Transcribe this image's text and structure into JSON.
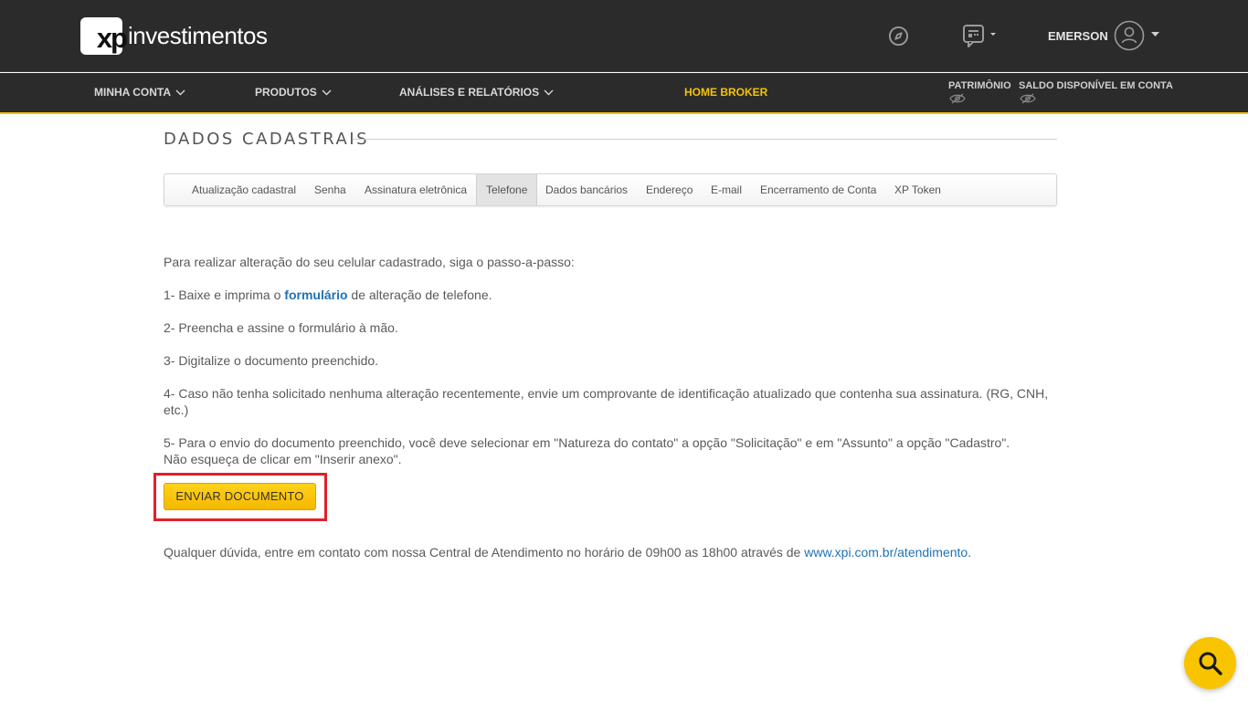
{
  "brand": {
    "logo_mark": "xp",
    "logo_word": "investimentos"
  },
  "header": {
    "user_name": "EMERSON"
  },
  "nav": {
    "items": [
      "MINHA CONTA",
      "PRODUTOS",
      "ANÁLISES E RELATÓRIOS"
    ],
    "home_broker": "HOME BROKER",
    "patrimonio": "PATRIMÔNIO",
    "saldo": "SALDO DISPONÍVEL EM CONTA"
  },
  "page": {
    "title": "DADOS CADASTRAIS"
  },
  "tabs": [
    "Atualização cadastral",
    "Senha",
    "Assinatura eletrônica",
    "Telefone",
    "Dados bancários",
    "Endereço",
    "E-mail",
    "Encerramento de Conta",
    "XP Token"
  ],
  "active_tab": "Telefone",
  "content": {
    "intro": "Para realizar alteração do seu celular cadastrado, siga o passo-a-passo:",
    "step1_prefix": "1- Baixe e imprima o ",
    "step1_link": "formulário",
    "step1_suffix": " de alteração de telefone.",
    "step2": "2- Preencha e assine o formulário à mão.",
    "step3": "3- Digitalize o documento preenchido.",
    "step4": "4- Caso não tenha solicitado nenhuma alteração recentemente, envie um comprovante de identificação atualizado que contenha sua assinatura. (RG, CNH, etc.)",
    "step5_line1": "5- Para o envio do documento preenchido, você deve selecionar em \"Natureza do contato\" a opção \"Solicitação\" e em \"Assunto\" a opção \"Cadastro\".",
    "step5_line2": "Não esqueça de clicar em \"Inserir anexo\".",
    "button": "ENVIAR DOCUMENTO",
    "footer_prefix": "Qualquer dúvida, entre em contato com nossa Central de Atendimento no horário de 09h00 as 18h00 através de ",
    "footer_link": "www.xpi.com.br/atendimento",
    "footer_suffix": "."
  },
  "colors": {
    "accent": "#f5c20c",
    "header_bg": "#2b2b2b",
    "link": "#1f72b5",
    "highlight": "#e0202a"
  },
  "icons": [
    "compass-icon",
    "chat-icon",
    "user-avatar-icon",
    "eye-hidden-icon",
    "search-icon",
    "chevron-down-icon"
  ]
}
